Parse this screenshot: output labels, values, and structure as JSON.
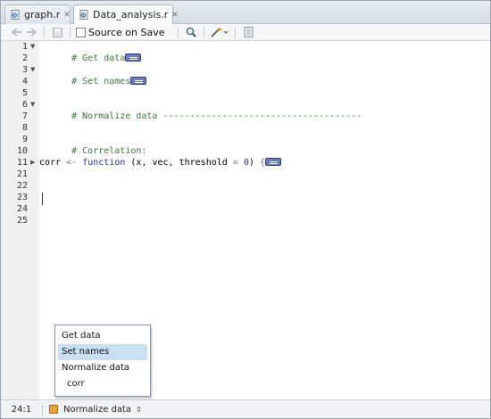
{
  "tabs": [
    {
      "label": "graph.r",
      "active": false
    },
    {
      "label": "Data_analysis.r",
      "active": true
    }
  ],
  "toolbar": {
    "source_on_save_label": "Source on Save",
    "source_on_save_checked": false
  },
  "editor": {
    "line_numbers": [
      "1",
      "2",
      "3",
      "4",
      "5",
      "6",
      "7",
      "8",
      "9",
      "10",
      "11",
      "21",
      "22",
      "23",
      "24",
      "25"
    ],
    "lines": {
      "l1": "# Get data",
      "l3": "# Set names",
      "l6": "# Normalize data -------------------------------------",
      "l9": "# Correlation:",
      "l11_name": "corr",
      "l11_arrow": "<-",
      "l11_kw": "function",
      "l11_args_a": "(x, vec, threshold",
      "l11_eq": "=",
      "l11_num": "0",
      "l11_close": ")",
      "l11_brace": "{"
    }
  },
  "popup": {
    "items": [
      "Get data",
      "Set names",
      "Normalize data",
      "corr"
    ],
    "selected": "Set names"
  },
  "status": {
    "cursor_position": "24:1",
    "scope": "Normalize data"
  }
}
